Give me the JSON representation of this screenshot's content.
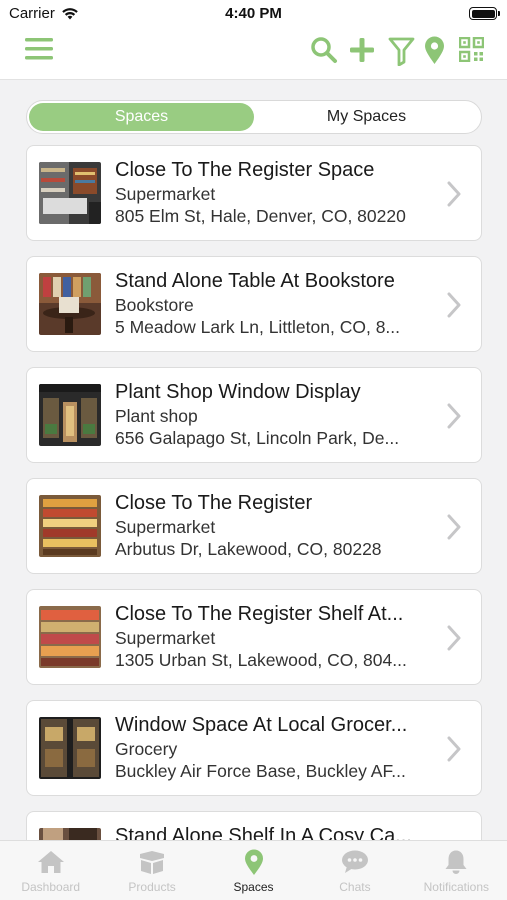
{
  "status_bar": {
    "carrier": "Carrier",
    "time": "4:40 PM"
  },
  "nav": {
    "icons": [
      "menu-icon",
      "search-icon",
      "add-icon",
      "filter-icon",
      "location-pin-icon",
      "qr-code-icon"
    ],
    "accent_color": "#8dc576"
  },
  "segment": {
    "options": [
      "Spaces",
      "My Spaces"
    ],
    "selected": "Spaces"
  },
  "spaces": [
    {
      "title": "Close To The Register Space",
      "type": "Supermarket",
      "address": "805 Elm St, Hale, Denver, CO, 80220"
    },
    {
      "title": "Stand Alone Table At Bookstore",
      "type": "Bookstore",
      "address": "5 Meadow Lark Ln, Littleton, CO, 8..."
    },
    {
      "title": "Plant Shop Window Display",
      "type": "Plant shop",
      "address": "656 Galapago St, Lincoln Park, De..."
    },
    {
      "title": "Close To The Register",
      "type": "Supermarket",
      "address": "Arbutus Dr, Lakewood, CO, 80228"
    },
    {
      "title": "Close To The Register Shelf At...",
      "type": "Supermarket",
      "address": "1305 Urban St, Lakewood, CO, 804..."
    },
    {
      "title": "Window Space At Local Grocer...",
      "type": "Grocery",
      "address": "Buckley Air Force Base, Buckley AF..."
    },
    {
      "title": "Stand Alone Shelf In A Cosy Ca...",
      "type": "",
      "address": ""
    }
  ],
  "tab_bar": {
    "tabs": [
      {
        "label": "Dashboard",
        "icon": "home-icon"
      },
      {
        "label": "Products",
        "icon": "box-icon"
      },
      {
        "label": "Spaces",
        "icon": "location-pin-icon"
      },
      {
        "label": "Chats",
        "icon": "chat-bubble-icon"
      },
      {
        "label": "Notifications",
        "icon": "bell-icon"
      }
    ],
    "selected": "Spaces"
  }
}
